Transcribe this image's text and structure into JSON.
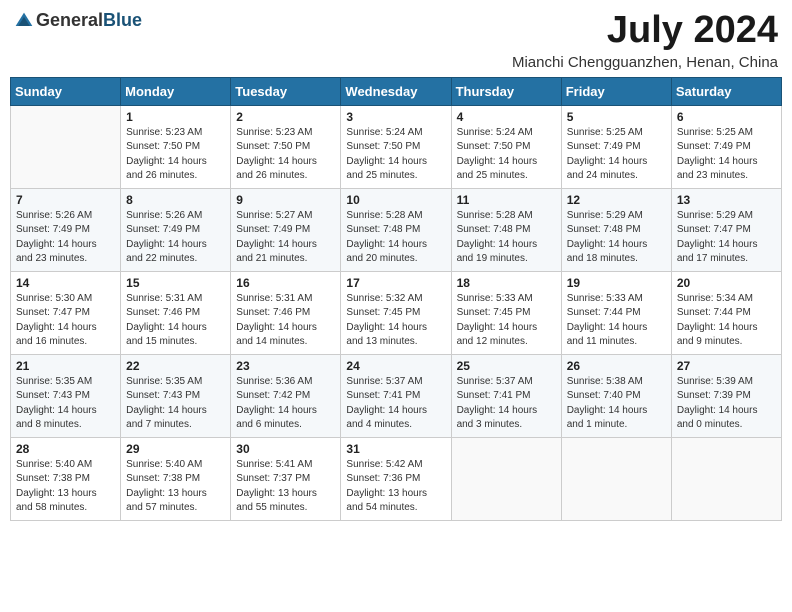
{
  "header": {
    "logo_general": "General",
    "logo_blue": "Blue",
    "month_title": "July 2024",
    "location": "Mianchi Chengguanzhen, Henan, China"
  },
  "days_of_week": [
    "Sunday",
    "Monday",
    "Tuesday",
    "Wednesday",
    "Thursday",
    "Friday",
    "Saturday"
  ],
  "weeks": [
    [
      {
        "day": "",
        "sunrise": "",
        "sunset": "",
        "daylight": ""
      },
      {
        "day": "1",
        "sunrise": "Sunrise: 5:23 AM",
        "sunset": "Sunset: 7:50 PM",
        "daylight": "Daylight: 14 hours and 26 minutes."
      },
      {
        "day": "2",
        "sunrise": "Sunrise: 5:23 AM",
        "sunset": "Sunset: 7:50 PM",
        "daylight": "Daylight: 14 hours and 26 minutes."
      },
      {
        "day": "3",
        "sunrise": "Sunrise: 5:24 AM",
        "sunset": "Sunset: 7:50 PM",
        "daylight": "Daylight: 14 hours and 25 minutes."
      },
      {
        "day": "4",
        "sunrise": "Sunrise: 5:24 AM",
        "sunset": "Sunset: 7:50 PM",
        "daylight": "Daylight: 14 hours and 25 minutes."
      },
      {
        "day": "5",
        "sunrise": "Sunrise: 5:25 AM",
        "sunset": "Sunset: 7:49 PM",
        "daylight": "Daylight: 14 hours and 24 minutes."
      },
      {
        "day": "6",
        "sunrise": "Sunrise: 5:25 AM",
        "sunset": "Sunset: 7:49 PM",
        "daylight": "Daylight: 14 hours and 23 minutes."
      }
    ],
    [
      {
        "day": "7",
        "sunrise": "Sunrise: 5:26 AM",
        "sunset": "Sunset: 7:49 PM",
        "daylight": "Daylight: 14 hours and 23 minutes."
      },
      {
        "day": "8",
        "sunrise": "Sunrise: 5:26 AM",
        "sunset": "Sunset: 7:49 PM",
        "daylight": "Daylight: 14 hours and 22 minutes."
      },
      {
        "day": "9",
        "sunrise": "Sunrise: 5:27 AM",
        "sunset": "Sunset: 7:49 PM",
        "daylight": "Daylight: 14 hours and 21 minutes."
      },
      {
        "day": "10",
        "sunrise": "Sunrise: 5:28 AM",
        "sunset": "Sunset: 7:48 PM",
        "daylight": "Daylight: 14 hours and 20 minutes."
      },
      {
        "day": "11",
        "sunrise": "Sunrise: 5:28 AM",
        "sunset": "Sunset: 7:48 PM",
        "daylight": "Daylight: 14 hours and 19 minutes."
      },
      {
        "day": "12",
        "sunrise": "Sunrise: 5:29 AM",
        "sunset": "Sunset: 7:48 PM",
        "daylight": "Daylight: 14 hours and 18 minutes."
      },
      {
        "day": "13",
        "sunrise": "Sunrise: 5:29 AM",
        "sunset": "Sunset: 7:47 PM",
        "daylight": "Daylight: 14 hours and 17 minutes."
      }
    ],
    [
      {
        "day": "14",
        "sunrise": "Sunrise: 5:30 AM",
        "sunset": "Sunset: 7:47 PM",
        "daylight": "Daylight: 14 hours and 16 minutes."
      },
      {
        "day": "15",
        "sunrise": "Sunrise: 5:31 AM",
        "sunset": "Sunset: 7:46 PM",
        "daylight": "Daylight: 14 hours and 15 minutes."
      },
      {
        "day": "16",
        "sunrise": "Sunrise: 5:31 AM",
        "sunset": "Sunset: 7:46 PM",
        "daylight": "Daylight: 14 hours and 14 minutes."
      },
      {
        "day": "17",
        "sunrise": "Sunrise: 5:32 AM",
        "sunset": "Sunset: 7:45 PM",
        "daylight": "Daylight: 14 hours and 13 minutes."
      },
      {
        "day": "18",
        "sunrise": "Sunrise: 5:33 AM",
        "sunset": "Sunset: 7:45 PM",
        "daylight": "Daylight: 14 hours and 12 minutes."
      },
      {
        "day": "19",
        "sunrise": "Sunrise: 5:33 AM",
        "sunset": "Sunset: 7:44 PM",
        "daylight": "Daylight: 14 hours and 11 minutes."
      },
      {
        "day": "20",
        "sunrise": "Sunrise: 5:34 AM",
        "sunset": "Sunset: 7:44 PM",
        "daylight": "Daylight: 14 hours and 9 minutes."
      }
    ],
    [
      {
        "day": "21",
        "sunrise": "Sunrise: 5:35 AM",
        "sunset": "Sunset: 7:43 PM",
        "daylight": "Daylight: 14 hours and 8 minutes."
      },
      {
        "day": "22",
        "sunrise": "Sunrise: 5:35 AM",
        "sunset": "Sunset: 7:43 PM",
        "daylight": "Daylight: 14 hours and 7 minutes."
      },
      {
        "day": "23",
        "sunrise": "Sunrise: 5:36 AM",
        "sunset": "Sunset: 7:42 PM",
        "daylight": "Daylight: 14 hours and 6 minutes."
      },
      {
        "day": "24",
        "sunrise": "Sunrise: 5:37 AM",
        "sunset": "Sunset: 7:41 PM",
        "daylight": "Daylight: 14 hours and 4 minutes."
      },
      {
        "day": "25",
        "sunrise": "Sunrise: 5:37 AM",
        "sunset": "Sunset: 7:41 PM",
        "daylight": "Daylight: 14 hours and 3 minutes."
      },
      {
        "day": "26",
        "sunrise": "Sunrise: 5:38 AM",
        "sunset": "Sunset: 7:40 PM",
        "daylight": "Daylight: 14 hours and 1 minute."
      },
      {
        "day": "27",
        "sunrise": "Sunrise: 5:39 AM",
        "sunset": "Sunset: 7:39 PM",
        "daylight": "Daylight: 14 hours and 0 minutes."
      }
    ],
    [
      {
        "day": "28",
        "sunrise": "Sunrise: 5:40 AM",
        "sunset": "Sunset: 7:38 PM",
        "daylight": "Daylight: 13 hours and 58 minutes."
      },
      {
        "day": "29",
        "sunrise": "Sunrise: 5:40 AM",
        "sunset": "Sunset: 7:38 PM",
        "daylight": "Daylight: 13 hours and 57 minutes."
      },
      {
        "day": "30",
        "sunrise": "Sunrise: 5:41 AM",
        "sunset": "Sunset: 7:37 PM",
        "daylight": "Daylight: 13 hours and 55 minutes."
      },
      {
        "day": "31",
        "sunrise": "Sunrise: 5:42 AM",
        "sunset": "Sunset: 7:36 PM",
        "daylight": "Daylight: 13 hours and 54 minutes."
      },
      {
        "day": "",
        "sunrise": "",
        "sunset": "",
        "daylight": ""
      },
      {
        "day": "",
        "sunrise": "",
        "sunset": "",
        "daylight": ""
      },
      {
        "day": "",
        "sunrise": "",
        "sunset": "",
        "daylight": ""
      }
    ]
  ]
}
